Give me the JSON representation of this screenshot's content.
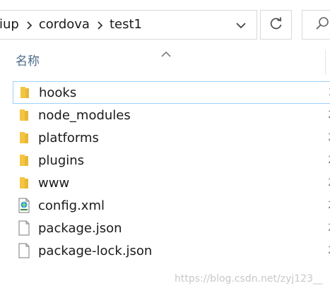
{
  "address_bar": {
    "breadcrumbs": [
      "iup",
      "cordova",
      "test1"
    ]
  },
  "search": {
    "placeholder": ""
  },
  "columns": {
    "name_header": "名称",
    "sort": "ascending"
  },
  "files": [
    {
      "name": "hooks",
      "type": "folder",
      "date_fragment": "2"
    },
    {
      "name": "node_modules",
      "type": "folder",
      "date_fragment": "2"
    },
    {
      "name": "platforms",
      "type": "folder",
      "date_fragment": "2"
    },
    {
      "name": "plugins",
      "type": "folder",
      "date_fragment": "2"
    },
    {
      "name": "www",
      "type": "folder",
      "date_fragment": "2"
    },
    {
      "name": "config.xml",
      "type": "xml-file",
      "date_fragment": "2"
    },
    {
      "name": "package.json",
      "type": "file",
      "date_fragment": "2"
    },
    {
      "name": "package-lock.json",
      "type": "file",
      "date_fragment": "2"
    }
  ],
  "icons": {
    "breadcrumb_separator": "chevron-right-icon",
    "dropdown": "chevron-down-icon",
    "refresh": "refresh-icon",
    "search": "search-icon",
    "folder": "folder-icon",
    "xml": "xml-file-icon",
    "file": "file-icon"
  },
  "colors": {
    "folder": "#f4c542",
    "header_text": "#4d6a8a",
    "focus_border": "#99d1ff"
  },
  "watermark": "https://blog.csdn.net/zyj123__"
}
